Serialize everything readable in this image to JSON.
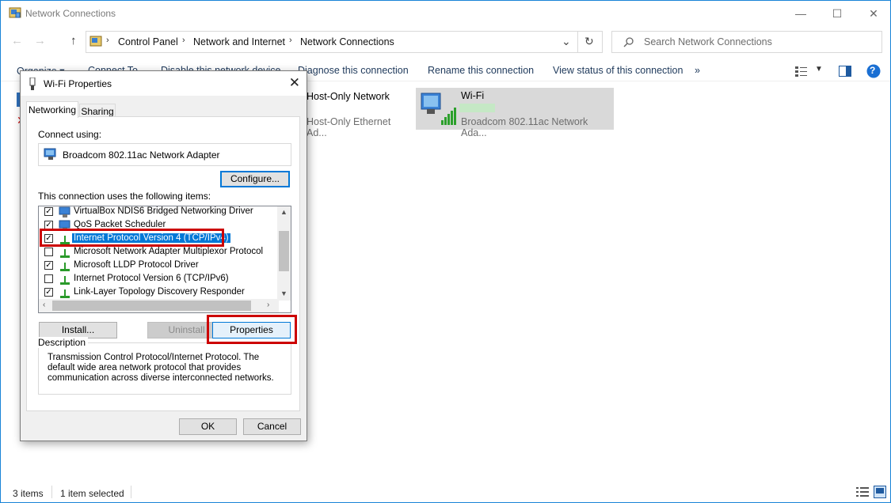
{
  "window": {
    "title": "Network Connections",
    "minimize": "—",
    "maximize": "☐",
    "close": "✕"
  },
  "nav": {
    "back": "←",
    "forward": "→",
    "up": "↑",
    "breadcrumb": [
      "Control Panel",
      "Network and Internet",
      "Network Connections"
    ],
    "dropdown": "⌄",
    "refresh": "↻",
    "search_placeholder": "Search Network Connections"
  },
  "commands": [
    "Organize ▾",
    "Connect To",
    "Disable this network device",
    "Diagnose this connection",
    "Rename this connection",
    "View status of this connection",
    "»"
  ],
  "view_controls": {
    "more": "»",
    "help": "?"
  },
  "connections": [
    {
      "name": "Host-Only Network",
      "detail": "Host-Only Ethernet Ad..."
    },
    {
      "name": "Wi-Fi",
      "detail": "Broadcom 802.11ac Network Ada..."
    }
  ],
  "statusbar": {
    "items": "3 items",
    "selected": "1 item selected"
  },
  "dialog": {
    "title": "Wi-Fi Properties",
    "close": "✕",
    "tabs": [
      "Networking",
      "Sharing"
    ],
    "connect_using_label": "Connect using:",
    "adapter": "Broadcom 802.11ac Network Adapter",
    "configure": "Configure...",
    "items_label": "This connection uses the following items:",
    "items": [
      {
        "label": "VirtualBox NDIS6 Bridged Networking Driver",
        "checked": true
      },
      {
        "label": "QoS Packet Scheduler",
        "checked": true
      },
      {
        "label": "Internet Protocol Version 4 (TCP/IPv4)",
        "checked": true,
        "selected": true
      },
      {
        "label": "Microsoft Network Adapter Multiplexor Protocol",
        "checked": false
      },
      {
        "label": "Microsoft LLDP Protocol Driver",
        "checked": true
      },
      {
        "label": "Internet Protocol Version 6 (TCP/IPv6)",
        "checked": false
      },
      {
        "label": "Link-Layer Topology Discovery Responder",
        "checked": true
      }
    ],
    "install": "Install...",
    "uninstall": "Uninstall",
    "properties": "Properties",
    "description_label": "Description",
    "description": "Transmission Control Protocol/Internet Protocol. The default wide area network protocol that provides communication across diverse interconnected networks.",
    "ok": "OK",
    "cancel": "Cancel"
  },
  "colors": {
    "accent": "#0078d7",
    "highlight": "#cc0000",
    "link": "#1e395b"
  }
}
